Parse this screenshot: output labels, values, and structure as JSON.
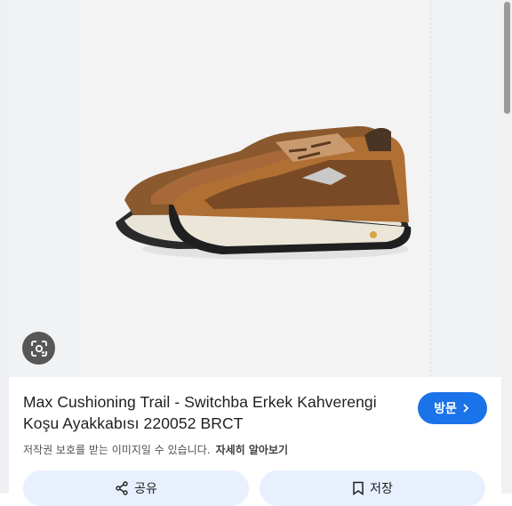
{
  "product": {
    "title_line1": "Max Cushioning Trail - Switchba Erkek Kahverengi",
    "title_line2": "Koşu Ayakkabısı 220052 BRCT"
  },
  "visit_button": {
    "label": "방문",
    "icon": "chevron-right-icon"
  },
  "notice": {
    "text": "저작권 보호를 받는 이미지일 수 있습니다.",
    "link": "자세히 알아보기"
  },
  "actions": {
    "share_label": "공유",
    "share_icon": "share-icon",
    "save_label": "저장",
    "save_icon": "bookmark-icon"
  },
  "lens": {
    "icon": "lens-search-icon"
  },
  "colors": {
    "accent": "#1a73e8",
    "action_bg": "#e8f0fe"
  }
}
